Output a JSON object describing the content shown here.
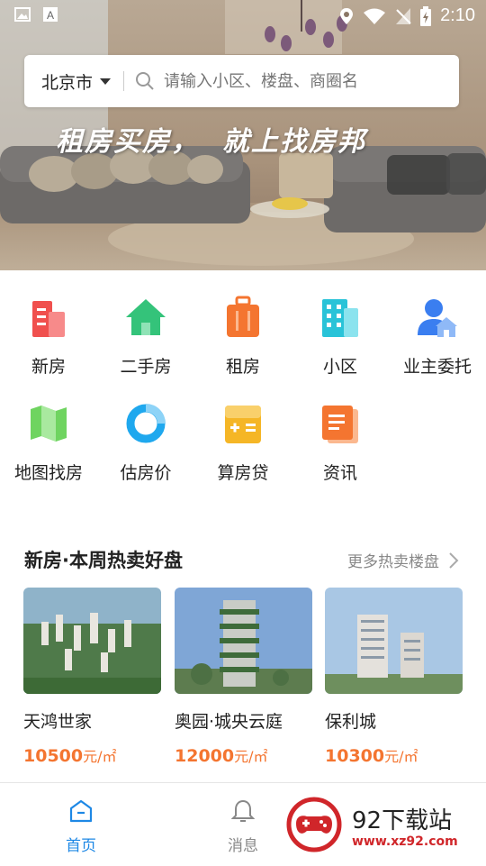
{
  "status_bar": {
    "time": "2:10"
  },
  "search": {
    "city": "北京市",
    "placeholder": "请输入小区、楼盘、商圈名"
  },
  "banner": {
    "slogan": "租房买房，  就上找房邦"
  },
  "categories": [
    {
      "label": "新房",
      "icon": "new-building-icon",
      "color": "#f0504e"
    },
    {
      "label": "二手房",
      "icon": "house-icon",
      "color": "#34c37a"
    },
    {
      "label": "租房",
      "icon": "suitcase-icon",
      "color": "#f47530"
    },
    {
      "label": "小区",
      "icon": "apartment-icon",
      "color": "#29c3d8"
    },
    {
      "label": "业主委托",
      "icon": "owner-person-icon",
      "color": "#3a7ef0"
    },
    {
      "label": "地图找房",
      "icon": "map-icon",
      "color": "#6fd460"
    },
    {
      "label": "估房价",
      "icon": "pie-chart-icon",
      "color": "#1fa8ee"
    },
    {
      "label": "算房贷",
      "icon": "calculator-icon",
      "color": "#f5b626"
    },
    {
      "label": "资讯",
      "icon": "news-document-icon",
      "color": "#f47530"
    }
  ],
  "hot_section": {
    "title": "新房·本周热卖好盘",
    "more": "更多热卖楼盘"
  },
  "listings": [
    {
      "name": "天鸿世家",
      "price": "10500",
      "unit": "元/㎡"
    },
    {
      "name": "奥园·城央云庭",
      "price": "12000",
      "unit": "元/㎡"
    },
    {
      "name": "保利城",
      "price": "10300",
      "unit": "元/㎡"
    }
  ],
  "tabbar": {
    "home": "首页",
    "messages": "消息"
  },
  "watermark": {
    "text": "92下载站",
    "url": "www.xz92.com"
  },
  "colors": {
    "accent": "#1e88e5",
    "price": "#f47530"
  }
}
